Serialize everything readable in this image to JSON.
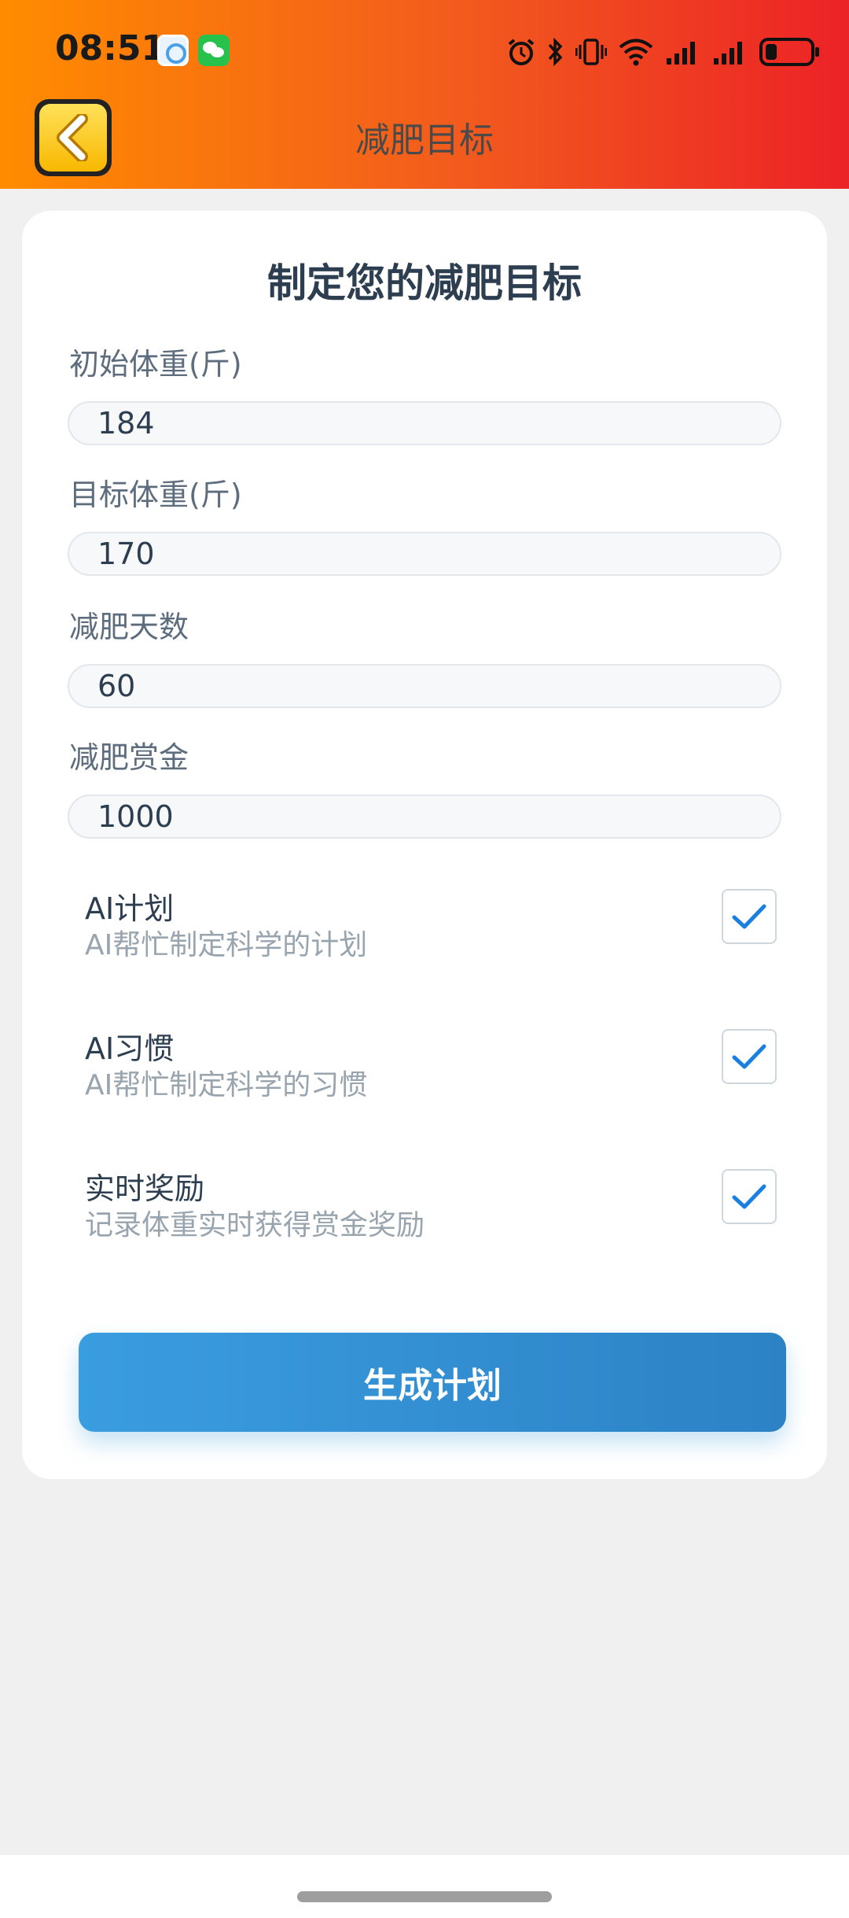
{
  "status_bar": {
    "time": "08:51",
    "battery_level": 0.25,
    "icons": [
      "notification-app-icon",
      "wechat-icon",
      "alarm-icon",
      "bluetooth-icon",
      "vibrate-icon",
      "wifi-icon",
      "signal-icon",
      "signal-icon",
      "battery-icon"
    ]
  },
  "nav": {
    "title": "减肥目标",
    "back_icon": "chevron-left-icon"
  },
  "form": {
    "title": "制定您的减肥目标",
    "fields": [
      {
        "label": "初始体重(斤)",
        "value": "184"
      },
      {
        "label": "目标体重(斤)",
        "value": "170"
      },
      {
        "label": "减肥天数",
        "value": "60"
      },
      {
        "label": "减肥赏金",
        "value": "1000"
      }
    ],
    "options": [
      {
        "title": "AI计划",
        "desc": "AI帮忙制定科学的计划",
        "checked": true
      },
      {
        "title": "AI习惯",
        "desc": "AI帮忙制定科学的习惯",
        "checked": true
      },
      {
        "title": "实时奖励",
        "desc": "记录体重实时获得赏金奖励",
        "checked": true
      }
    ],
    "submit_label": "生成计划"
  },
  "colors": {
    "header_start": "#ff8c00",
    "header_end": "#ec2226",
    "button": "#3498db",
    "check": "#1a7fe0"
  }
}
